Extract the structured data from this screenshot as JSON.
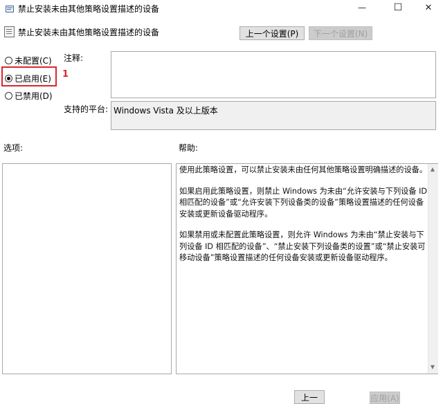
{
  "window": {
    "title": "禁止安装未由其他策略设置描述的设备",
    "controls": {
      "minimize": "—",
      "maximize": "☐",
      "close": "✕"
    }
  },
  "header": {
    "policy_title": "禁止安装未由其他策略设置描述的设备",
    "prev_label": "上一个设置(P)",
    "next_label": "下一个设置(N)"
  },
  "state": {
    "options": [
      {
        "label": "未配置(C)",
        "checked": false
      },
      {
        "label": "已启用(E)",
        "checked": true
      },
      {
        "label": "已禁用(D)",
        "checked": false
      }
    ],
    "annotation_number": "1",
    "annotation_color": "#d9262c"
  },
  "comment": {
    "label": "注释:",
    "value": ""
  },
  "platform": {
    "label": "支持的平台:",
    "value": "Windows Vista 及以上版本"
  },
  "options_section": {
    "label": "选项:"
  },
  "help_section": {
    "label": "帮助:",
    "paragraphs": [
      "使用此策略设置，可以禁止安装未由任何其他策略设置明确描述的设备。",
      "如果启用此策略设置，则禁止 Windows 为未由“允许安装与下列设备 ID 相匹配的设备”或“允许安装下列设备类的设备”策略设置描述的任何设备安装或更新设备驱动程序。",
      "如果禁用或未配置此策略设置，则允许 Windows 为未由“禁止安装与下列设备 ID 相匹配的设备”、“禁止安装下列设备类的设置”或“禁止安装可移动设备”策略设置描述的任何设备安装或更新设备驱动程序。"
    ]
  },
  "footer": {
    "button1_label": "上一",
    "button2_label": "应用(A)"
  }
}
